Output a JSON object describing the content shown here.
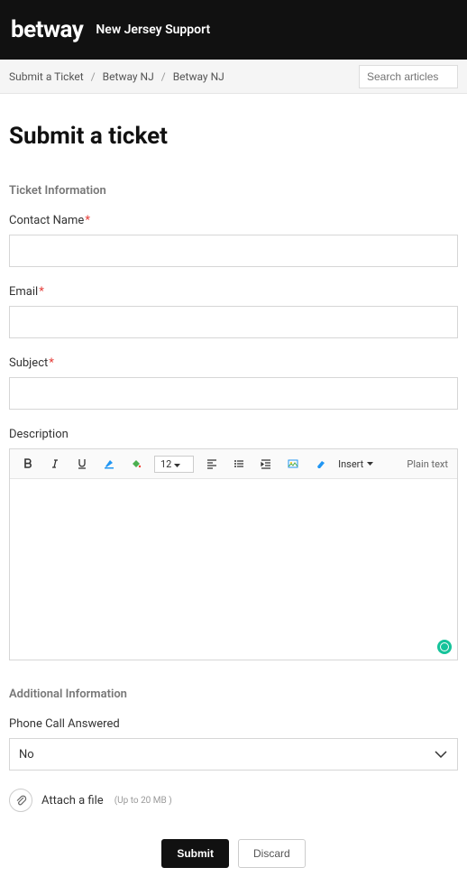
{
  "header": {
    "logo": "betway",
    "portal": "New Jersey Support"
  },
  "breadcrumbs": {
    "items": [
      "Submit a Ticket",
      "Betway NJ",
      "Betway NJ"
    ]
  },
  "search": {
    "placeholder": "Search articles"
  },
  "page": {
    "title": "Submit a ticket",
    "section_ticket": "Ticket Information",
    "section_additional": "Additional Information"
  },
  "fields": {
    "contact": {
      "label": "Contact Name",
      "value": ""
    },
    "email": {
      "label": "Email",
      "value": ""
    },
    "subject": {
      "label": "Subject",
      "value": ""
    },
    "description": {
      "label": "Description",
      "value": ""
    },
    "phone_answered": {
      "label": "Phone Call Answered",
      "value": "No"
    }
  },
  "editor": {
    "font_size": "12",
    "insert": "Insert",
    "plain_text": "Plain text"
  },
  "attach": {
    "label": "Attach a file",
    "hint": "(Up to 20 MB )"
  },
  "actions": {
    "submit": "Submit",
    "discard": "Discard"
  }
}
